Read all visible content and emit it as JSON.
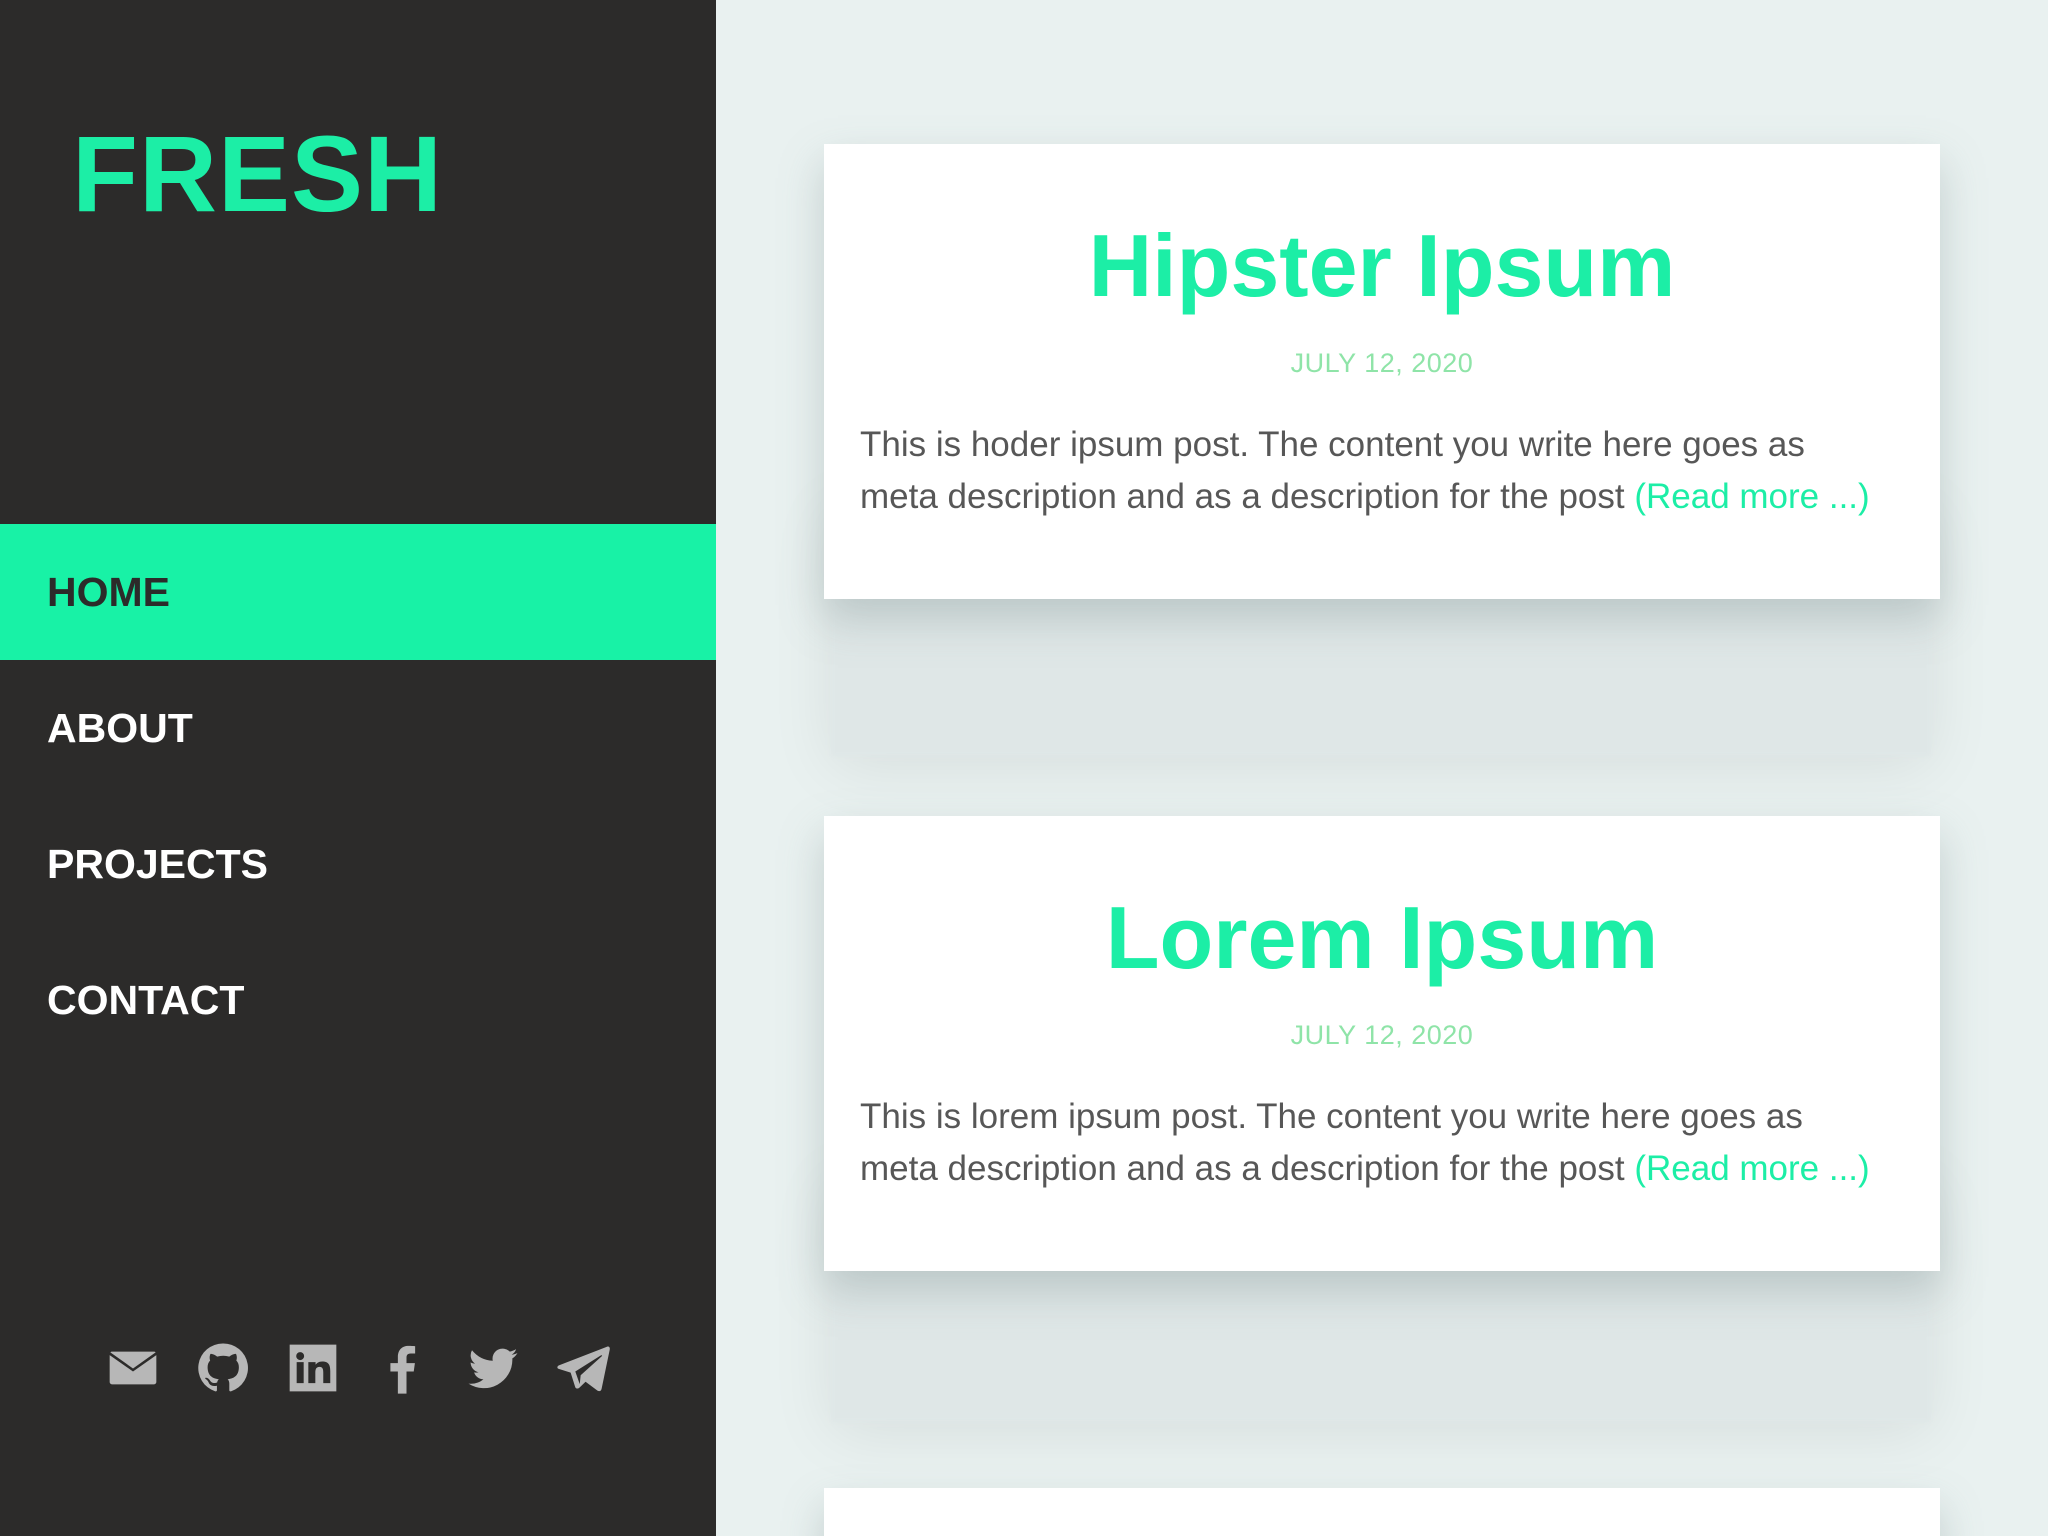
{
  "brand": "FRESH",
  "nav": [
    {
      "label": "HOME",
      "active": true
    },
    {
      "label": "ABOUT",
      "active": false
    },
    {
      "label": "PROJECTS",
      "active": false
    },
    {
      "label": "CONTACT",
      "active": false
    }
  ],
  "socials": [
    "mail-icon",
    "github-icon",
    "linkedin-icon",
    "facebook-icon",
    "twitter-icon",
    "telegram-icon"
  ],
  "posts": [
    {
      "title": "Hipster Ipsum",
      "date": "JULY 12, 2020",
      "excerpt": "This is hoder ipsum post. The content you write here goes as meta description and as a description for the post",
      "read_more": "(Read more ...)"
    },
    {
      "title": "Lorem Ipsum",
      "date": "JULY 12, 2020",
      "excerpt": "This is lorem ipsum post. The content you write here goes as meta description and as a description for the post",
      "read_more": "(Read more ...)"
    }
  ],
  "colors": {
    "accent": "#18f2a6",
    "sidebar_bg": "#2c2b2a",
    "page_bg": "#e9f1f0",
    "date": "#8fe4a8",
    "icon": "#b7b7b7"
  }
}
